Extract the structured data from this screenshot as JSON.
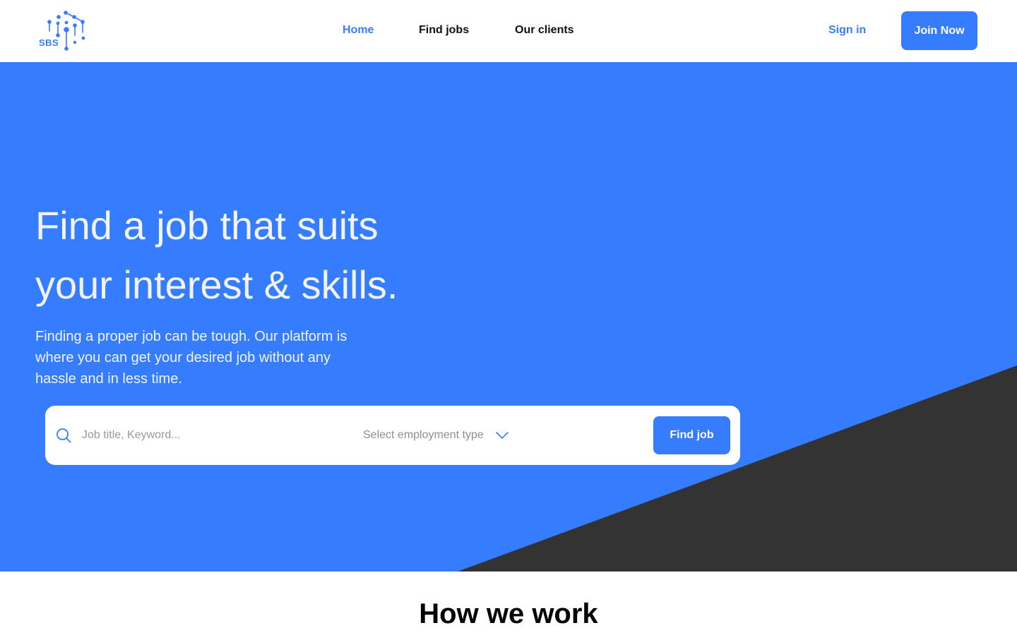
{
  "brand": {
    "logo_text": "SBS",
    "accent_color": "#367cff",
    "dark_color": "#333333"
  },
  "nav": {
    "items": [
      {
        "label": "Home",
        "active": true
      },
      {
        "label": "Find jobs",
        "active": false
      },
      {
        "label": "Our clients",
        "active": false
      }
    ],
    "signin_label": "Sign in",
    "join_label": "Join Now"
  },
  "hero": {
    "title_line1": "Find a job that suits",
    "title_line2": "your interest & skills.",
    "subtitle": "Finding a proper job can be tough. Our platform is where you can get your desired job without any hassle and in less time.",
    "search": {
      "icon": "search-icon",
      "placeholder": "Job title, Keyword...",
      "employment_placeholder": "Select employment type",
      "button_label": "Find job"
    }
  },
  "section": {
    "title": "How we work"
  }
}
